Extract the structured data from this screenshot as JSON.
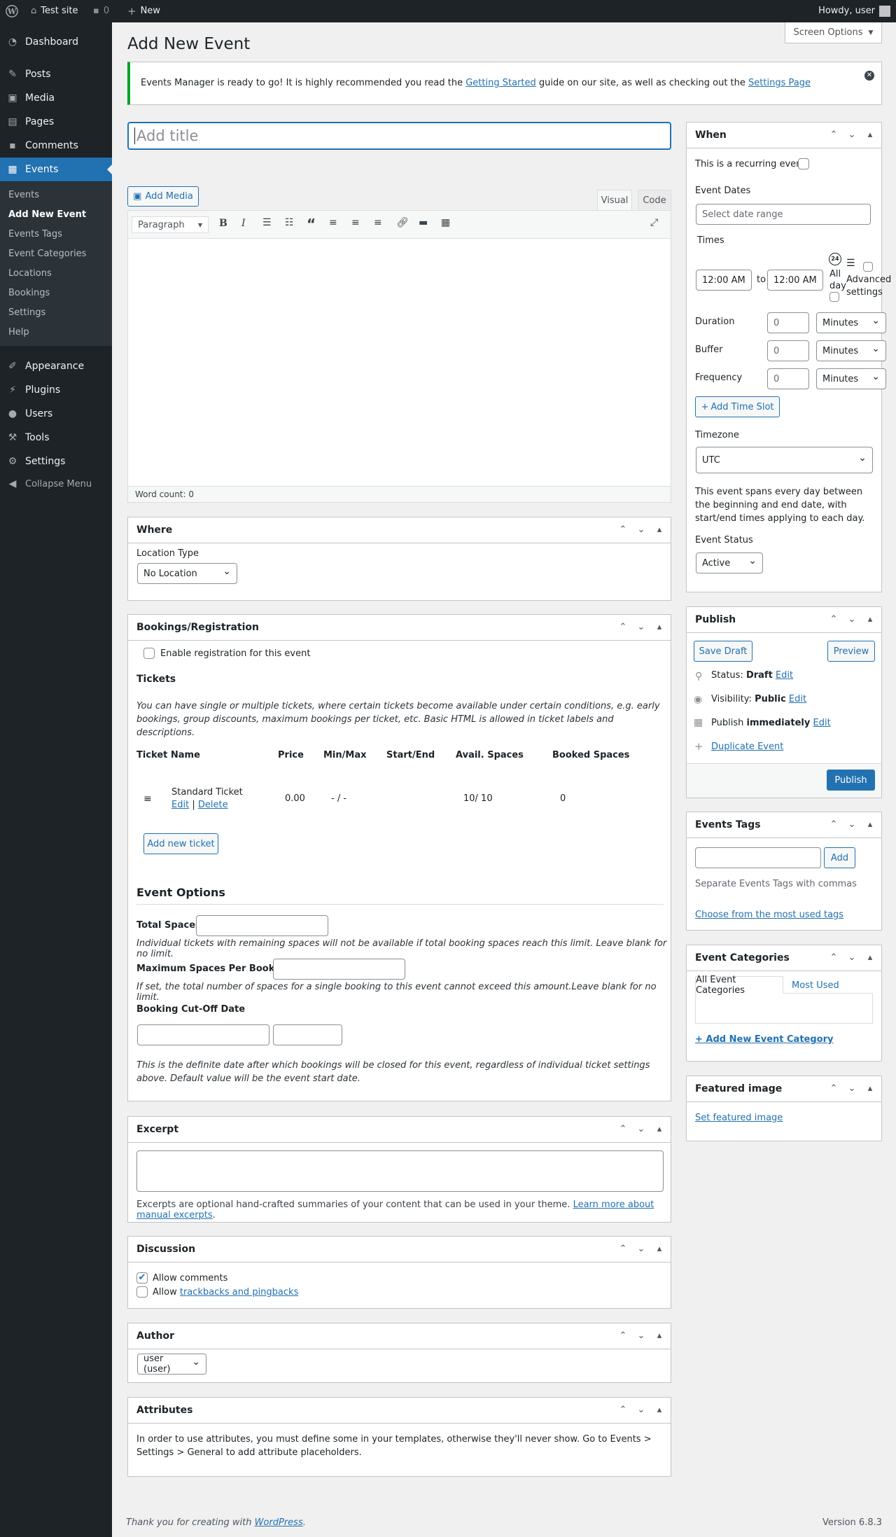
{
  "adminbar": {
    "site": "Test site",
    "comments": "0",
    "new": "New",
    "howdy": "Howdy, user"
  },
  "menu": {
    "dashboard": "Dashboard",
    "posts": "Posts",
    "media": "Media",
    "pages": "Pages",
    "comments": "Comments",
    "events": "Events",
    "appearance": "Appearance",
    "plugins": "Plugins",
    "users": "Users",
    "tools": "Tools",
    "settings": "Settings",
    "collapse": "Collapse Menu",
    "sub": [
      "Events",
      "Add New Event",
      "Events Tags",
      "Event Categories",
      "Locations",
      "Bookings",
      "Settings",
      "Help"
    ]
  },
  "page": {
    "title": "Add New Event",
    "screen_options": "Screen Options"
  },
  "notice": {
    "pre": "Events Manager is ready to go! It is highly recommended you read the ",
    "link1": "Getting Started",
    "mid": " guide on our site, as well as checking out the ",
    "link2": "Settings Page"
  },
  "editor": {
    "title_placeholder": "Add title",
    "add_media": "Add Media",
    "tab_visual": "Visual",
    "tab_code": "Code",
    "format": "Paragraph",
    "word_count": "Word count: 0"
  },
  "where": {
    "title": "Where",
    "location_type_label": "Location Type",
    "location_type": "No Location"
  },
  "bookings": {
    "title": "Bookings/Registration",
    "enable": "Enable registration for this event",
    "tickets_heading": "Tickets",
    "tickets_desc": "You can have single or multiple tickets, where certain tickets become available under certain conditions, e.g. early bookings, group discounts, maximum bookings per ticket, etc. Basic HTML is allowed in ticket labels and descriptions.",
    "columns": [
      "Ticket Name",
      "Price",
      "Min/Max",
      "Start/End",
      "Avail. Spaces",
      "Booked Spaces"
    ],
    "ticket": {
      "name": "Standard Ticket",
      "edit": "Edit",
      "sep": "|",
      "delete": "Delete",
      "price": "0.00",
      "minmax": "- / -",
      "avail": "10/ 10",
      "booked": "0"
    },
    "add_ticket": "Add new ticket",
    "options_heading": "Event Options",
    "total_spaces": "Total Spaces",
    "total_spaces_desc": "Individual tickets with remaining spaces will not be available if total booking spaces reach this limit. Leave blank for no limit.",
    "max_spaces": "Maximum Spaces Per Booking",
    "max_spaces_desc": "If set, the total number of spaces for a single booking to this event cannot exceed this amount.Leave blank for no limit.",
    "cutoff": "Booking Cut-Off Date",
    "cutoff_desc": "This is the definite date after which bookings will be closed for this event, regardless of individual ticket settings above. Default value will be the event start date."
  },
  "excerpt": {
    "title": "Excerpt",
    "desc": "Excerpts are optional hand-crafted summaries of your content that can be used in your theme. ",
    "link": "Learn more about manual excerpts",
    "end": "."
  },
  "discussion": {
    "title": "Discussion",
    "allow_comments": "Allow comments",
    "allow_pre": "Allow ",
    "trackbacks": "trackbacks and pingbacks"
  },
  "author": {
    "title": "Author",
    "value": "user (user)"
  },
  "attributes": {
    "title": "Attributes",
    "desc": "In order to use attributes, you must define some in your templates, otherwise they'll never show. Go to Events > Settings > General to add attribute placeholders."
  },
  "when": {
    "title": "When",
    "recurring": "This is a recurring event.",
    "dates_label": "Event Dates",
    "dates_placeholder": "Select date range",
    "times_label": "Times",
    "start": "12:00 AM",
    "to": "to",
    "end": "12:00 AM",
    "allday": "All day",
    "advanced": "Advanced settings",
    "duration": "Duration",
    "buffer": "Buffer",
    "frequency": "Frequency",
    "num": "0",
    "unit": "Minutes",
    "add_slot": "Add Time Slot",
    "timezone_label": "Timezone",
    "timezone": "UTC",
    "spans": "This event spans every day between the beginning and end date, with start/end times applying to each day.",
    "status_label": "Event Status",
    "status": "Active"
  },
  "publish": {
    "title": "Publish",
    "save_draft": "Save Draft",
    "preview": "Preview",
    "status_label": "Status:",
    "status": "Draft",
    "visibility_label": "Visibility:",
    "visibility": "Public",
    "publish_label": "Publish",
    "publish_when": "immediately",
    "edit": "Edit",
    "duplicate": "Duplicate Event",
    "publish_btn": "Publish"
  },
  "tags": {
    "title": "Events Tags",
    "add": "Add",
    "help": "Separate Events Tags with commas",
    "choose": "Choose from the most used tags"
  },
  "categories": {
    "title": "Event Categories",
    "tab_all": "All Event Categories",
    "tab_used": "Most Used",
    "add_new": "+ Add New Event Category"
  },
  "featured": {
    "title": "Featured image",
    "set": "Set featured image"
  },
  "footer": {
    "thanks": "Thank you for creating with ",
    "wp": "WordPress",
    "dot": ".",
    "version": "Version 6.8.3"
  }
}
